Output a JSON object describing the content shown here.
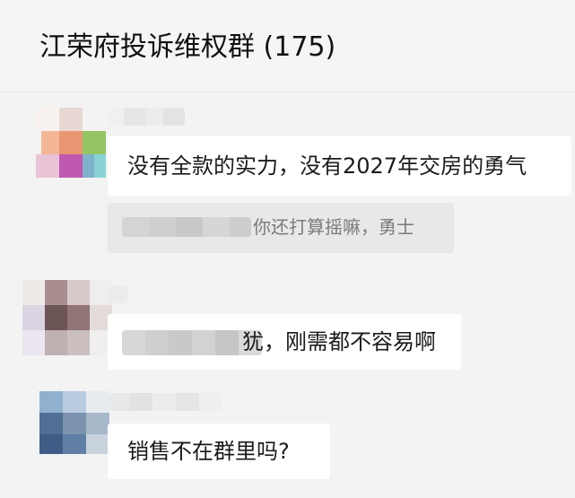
{
  "header": {
    "title": "江荣府投诉维权群 (175)"
  },
  "messages": [
    {
      "text": "没有全款的实力，没有2027年交房的勇气",
      "quote_text": "你还打算摇嘛，勇士"
    },
    {
      "text": "犹，刚需都不容易啊"
    },
    {
      "text": "销售不在群里吗?"
    }
  ],
  "colors": {
    "background": "#f3f3f3",
    "bubble": "#ffffff",
    "quote_background": "#e8e8e8",
    "quote_text": "#7a7a7a"
  }
}
